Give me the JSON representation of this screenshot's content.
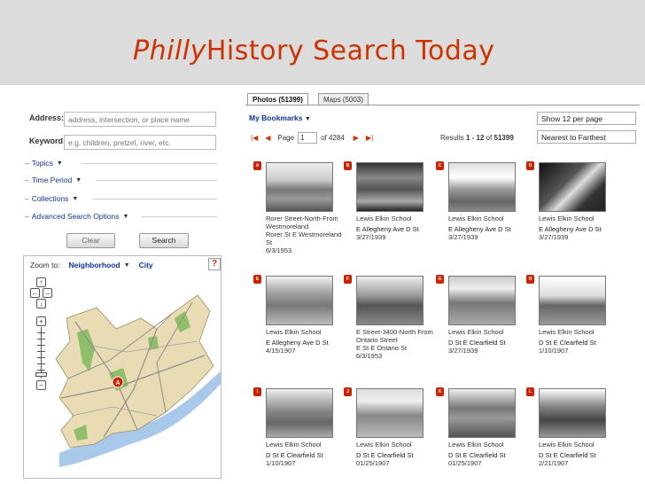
{
  "banner": {
    "title_italic": "Philly",
    "title_rest": "History Search Today"
  },
  "search": {
    "address_label": "Address:",
    "address_placeholder": "address, intersection, or place name",
    "keyword_label": "Keyword:",
    "keyword_placeholder": "e.g. children, pretzel, river, etc.",
    "sections": [
      "Topics",
      "Time Period",
      "Collections",
      "Advanced Search Options"
    ],
    "clear_label": "Clear",
    "search_label": "Search"
  },
  "map": {
    "zoom_label": "Zoom to:",
    "neighborhood_label": "Neighborhood",
    "city_label": "City",
    "help_label": "?",
    "marker_label": "A",
    "colors": {
      "land": "#e9dcb4",
      "water": "#a9c9ea",
      "parks": "#8fbf6a",
      "roads": "#8f8f8f",
      "accent": "#cc3300"
    }
  },
  "results_panel": {
    "tab_photos": "Photos (51399)",
    "tab_maps": "Maps (5003)",
    "bookmarks": "My Bookmarks",
    "per_page": "Show 12 per page",
    "sort": "Nearest to Farthest",
    "page_label": "Page",
    "page_value": "1",
    "of_label": "of 4284",
    "results_prefix": "Results",
    "results_range": "1 - 12",
    "results_of": "of",
    "results_total": "51399"
  },
  "items": [
    {
      "badge": "A",
      "title": "Rorer Street-North-From Westmoreland",
      "location": "Rorer St E Westmoreland St",
      "date": "6/3/1953"
    },
    {
      "badge": "B",
      "title": "Lewis Elkin School",
      "location": "E Allegheny Ave D St",
      "date": "3/27/1939"
    },
    {
      "badge": "C",
      "title": "Lewis Elkin School",
      "location": "E Allegheny Ave D St",
      "date": "3/27/1939"
    },
    {
      "badge": "D",
      "title": "Lewis Elkin School",
      "location": "E Allegheny Ave D St",
      "date": "3/27/1939"
    },
    {
      "badge": "E",
      "title": "Lewis Elkin School",
      "location": "E Allegheny Ave D St",
      "date": "4/15/1907"
    },
    {
      "badge": "F",
      "title": "E Street-3400-North From Ontario Street",
      "location": "E St E Ontario St",
      "date": "6/3/1953"
    },
    {
      "badge": "G",
      "title": "Lewis Elkin School",
      "location": "D St E Clearfield St",
      "date": "3/27/1939"
    },
    {
      "badge": "H",
      "title": "Lewis Elkin School",
      "location": "D St E Clearfield St",
      "date": "1/10/1907"
    },
    {
      "badge": "I",
      "title": "Lewis Elkin School",
      "location": "D St E Clearfield St",
      "date": "1/10/1907"
    },
    {
      "badge": "J",
      "title": "Lewis Elkin School",
      "location": "D St E Clearfield St",
      "date": "01/25/1907"
    },
    {
      "badge": "K",
      "title": "Lewis Elkin School",
      "location": "D St E Clearfield St",
      "date": "01/25/1907"
    },
    {
      "badge": "L",
      "title": "Lewis Elkin School",
      "location": "D St E Clearfield St",
      "date": "2/21/1907"
    }
  ]
}
